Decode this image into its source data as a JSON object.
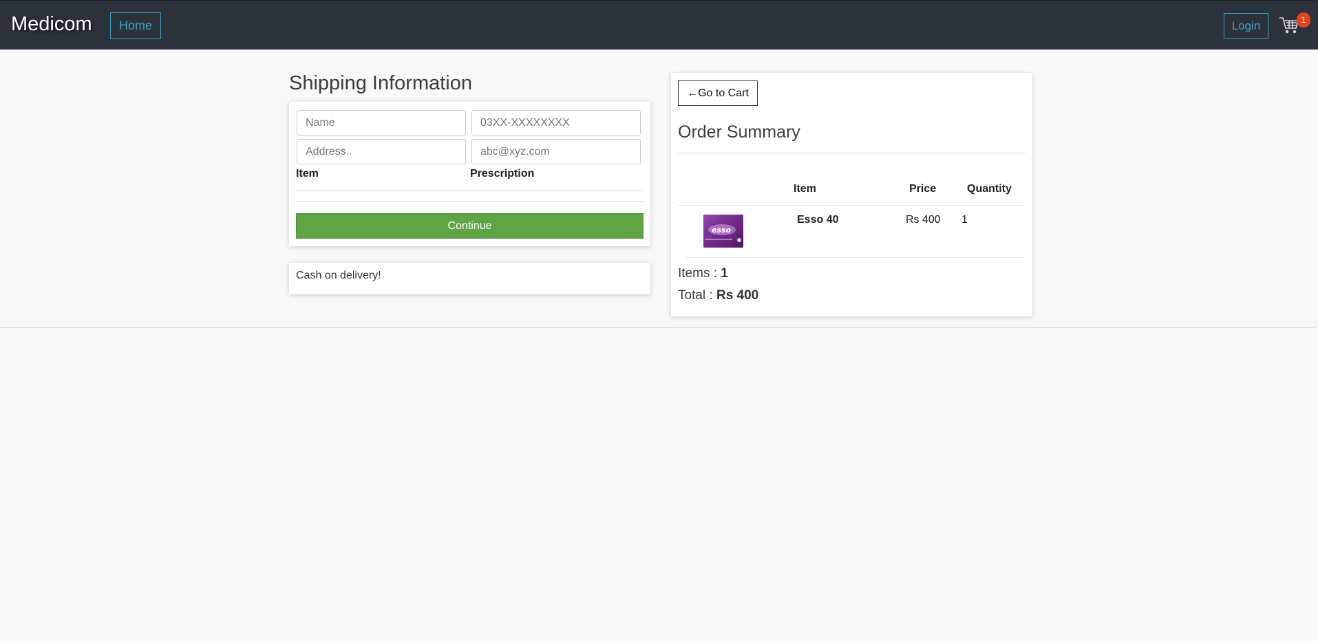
{
  "navbar": {
    "brand": "Medicom",
    "home_label": "Home",
    "login_label": "Login",
    "cart_count": "1",
    "cart_icon": "cart-icon",
    "bg_color": "#2d313a",
    "accent_color": "#39a6c1",
    "badge_color": "#e8421a"
  },
  "shipping": {
    "title": "Shipping Information",
    "name_placeholder": "Name",
    "name_value": "",
    "phone_placeholder": "03XX-XXXXXXXX",
    "phone_value": "",
    "address_placeholder": "Address..",
    "address_value": "",
    "email_placeholder": "abc@xyz.com",
    "email_value": "",
    "col_item": "Item",
    "col_prescription": "Prescription",
    "continue_label": "Continue",
    "continue_color": "#5ea544",
    "payment_note": "Cash on delivery!"
  },
  "order": {
    "back_label": "←Go to Cart",
    "title": "Order Summary",
    "columns": [
      "Item",
      "Price",
      "Quantity"
    ],
    "rows": [
      {
        "image": "esso-40-product-image",
        "item": "Esso 40",
        "price": "Rs 400",
        "quantity": "1"
      }
    ],
    "items_label": "Items : ",
    "items_count": "1",
    "total_label": "Total : ",
    "total_value": "Rs 400"
  }
}
